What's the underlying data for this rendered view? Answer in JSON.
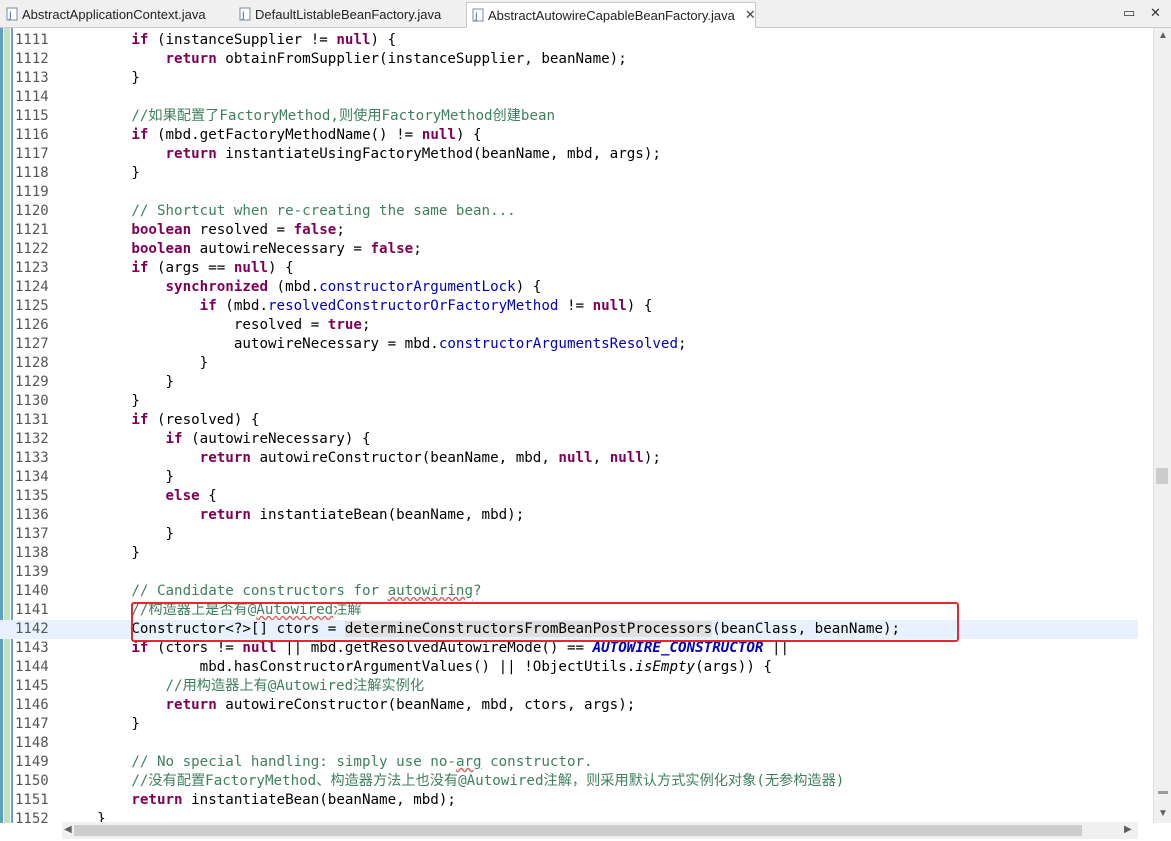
{
  "tabs": [
    {
      "label": "AbstractApplicationContext.java",
      "active": false
    },
    {
      "label": "DefaultListableBeanFactory.java",
      "active": false
    },
    {
      "label": "AbstractAutowireCapableBeanFactory.java",
      "active": true
    }
  ],
  "tab_close_glyph": "✕",
  "window_controls": {
    "restore": "▭",
    "close": "✕"
  },
  "colors": {
    "keyword": "#7f0055",
    "comment": "#3f7f5f",
    "field": "#0000c0",
    "highlight_box": "#e8262e",
    "current_line": "#e8f2fe"
  },
  "code_lines": [
    {
      "n": "1111",
      "t": "        <span class='kw'>if</span> (instanceSupplier != <span class='kw'>null</span>) {"
    },
    {
      "n": "1112",
      "t": "            <span class='kw'>return</span> obtainFromSupplier(instanceSupplier, beanName);"
    },
    {
      "n": "1113",
      "t": "        }"
    },
    {
      "n": "1114",
      "t": ""
    },
    {
      "n": "1115",
      "t": "        <span class='cm'>//如果配置了FactoryMethod,则使用FactoryMethod创建bean</span>"
    },
    {
      "n": "1116",
      "t": "        <span class='kw'>if</span> (mbd.getFactoryMethodName() != <span class='kw'>null</span>) {"
    },
    {
      "n": "1117",
      "t": "            <span class='kw'>return</span> instantiateUsingFactoryMethod(beanName, mbd, args);"
    },
    {
      "n": "1118",
      "t": "        }"
    },
    {
      "n": "1119",
      "t": ""
    },
    {
      "n": "1120",
      "t": "        <span class='cm'>// Shortcut when re-creating the same bean...</span>"
    },
    {
      "n": "1121",
      "t": "        <span class='kw'>boolean</span> resolved = <span class='kw'>false</span>;"
    },
    {
      "n": "1122",
      "t": "        <span class='kw'>boolean</span> autowireNecessary = <span class='kw'>false</span>;"
    },
    {
      "n": "1123",
      "t": "        <span class='kw'>if</span> (args == <span class='kw'>null</span>) {"
    },
    {
      "n": "1124",
      "t": "            <span class='kw'>synchronized</span> (mbd.<span class='fd'>constructorArgumentLock</span>) {"
    },
    {
      "n": "1125",
      "t": "                <span class='kw'>if</span> (mbd.<span class='fd'>resolvedConstructorOrFactoryMethod</span> != <span class='kw'>null</span>) {"
    },
    {
      "n": "1126",
      "t": "                    resolved = <span class='kw'>true</span>;"
    },
    {
      "n": "1127",
      "t": "                    autowireNecessary = mbd.<span class='fd'>constructorArgumentsResolved</span>;"
    },
    {
      "n": "1128",
      "t": "                }"
    },
    {
      "n": "1129",
      "t": "            }"
    },
    {
      "n": "1130",
      "t": "        }"
    },
    {
      "n": "1131",
      "t": "        <span class='kw'>if</span> (resolved) {"
    },
    {
      "n": "1132",
      "t": "            <span class='kw'>if</span> (autowireNecessary) {"
    },
    {
      "n": "1133",
      "t": "                <span class='kw'>return</span> autowireConstructor(beanName, mbd, <span class='kw'>null</span>, <span class='kw'>null</span>);"
    },
    {
      "n": "1134",
      "t": "            }"
    },
    {
      "n": "1135",
      "t": "            <span class='kw'>else</span> {"
    },
    {
      "n": "1136",
      "t": "                <span class='kw'>return</span> instantiateBean(beanName, mbd);"
    },
    {
      "n": "1137",
      "t": "            }"
    },
    {
      "n": "1138",
      "t": "        }"
    },
    {
      "n": "1139",
      "t": ""
    },
    {
      "n": "1140",
      "t": "        <span class='cm'>// Candidate constructors for <span class='sq'>autowiring</span>?</span>"
    },
    {
      "n": "1141",
      "t": "        <span class='cm'>//构造器上是否有@<span class='sq'>Autowired</span>注解</span>"
    },
    {
      "n": "1142",
      "t": "        Constructor&lt;?&gt;[] ctors = <span class='hl'>determineConstructorsFromBeanPostProcessors</span>(beanClass, beanName);",
      "current": true
    },
    {
      "n": "1143",
      "t": "        <span class='kw'>if</span> (ctors != <span class='kw'>null</span> || mbd.getResolvedAutowireMode() == <span class='sf'>AUTOWIRE_CONSTRUCTOR</span> ||"
    },
    {
      "n": "1144",
      "t": "                mbd.hasConstructorArgumentValues() || !ObjectUtils.<span class='it'>isEmpty</span>(args)) {"
    },
    {
      "n": "1145",
      "t": "            <span class='cm'>//用构造器上有@Autowired注解实例化</span>"
    },
    {
      "n": "1146",
      "t": "            <span class='kw'>return</span> autowireConstructor(beanName, mbd, ctors, args);"
    },
    {
      "n": "1147",
      "t": "        }"
    },
    {
      "n": "1148",
      "t": ""
    },
    {
      "n": "1149",
      "t": "        <span class='cm'>// No special handling: simply use no-<span class='sq'>arg</span> constructor.</span>"
    },
    {
      "n": "1150",
      "t": "        <span class='cm'>//没有配置FactoryMethod、构造器方法上也没有@Autowired注解，则采用默认方式实例化对象(无参构造器)</span>"
    },
    {
      "n": "1151",
      "t": "        <span class='kw'>return</span> instantiateBean(beanName, mbd);"
    },
    {
      "n": "1152",
      "t": "    }"
    }
  ]
}
